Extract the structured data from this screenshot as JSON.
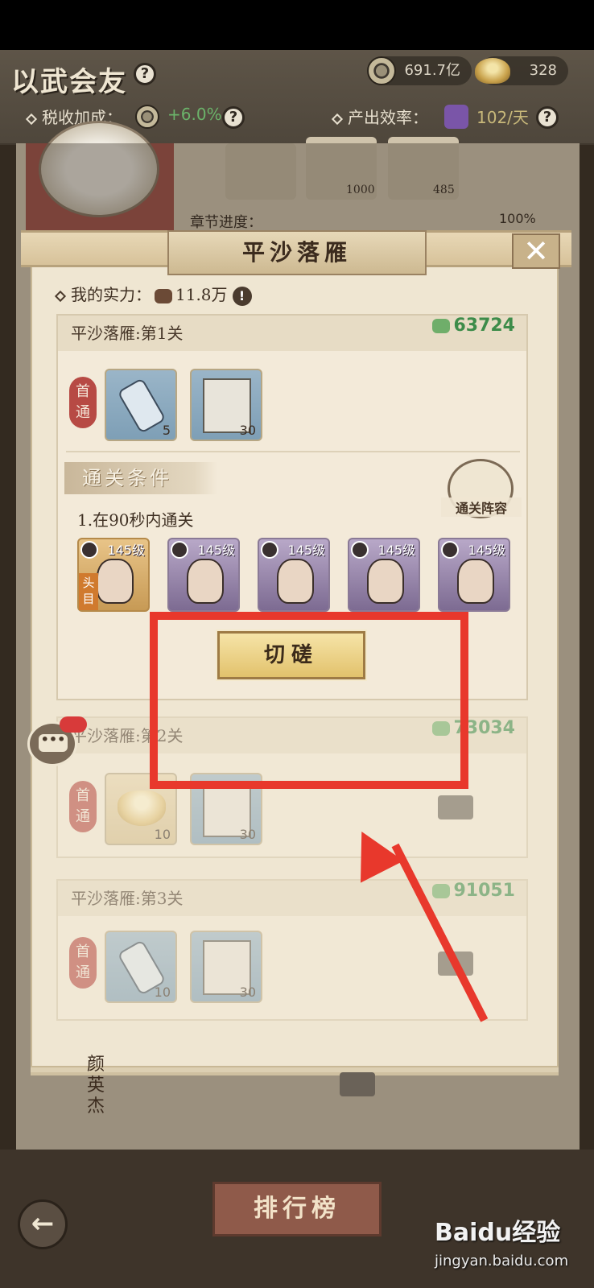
{
  "header": {
    "title": "以武会友",
    "coins": "691.7亿",
    "ingots": "328",
    "tax_label": "税收加成：",
    "tax_value": "+6.0%",
    "output_label": "产出效率：",
    "output_value": "102/天"
  },
  "background": {
    "chapter_progress_label": "章节进度：",
    "chapter_progress_value": "100%",
    "tile_values": [
      "1000",
      "485"
    ],
    "side_name": "颜英杰"
  },
  "dialog": {
    "title": "平沙落雁",
    "power_label": "我的实力：",
    "power_value": "11.8万",
    "first_clear_label": "首通",
    "conditions_title": "通关条件",
    "team_label": "通关阵容",
    "condition_1": "1.在90秒内通关",
    "spar_button": "切磋",
    "stages": [
      {
        "name": "平沙落雁:第1关",
        "power": "63724",
        "rewards": [
          {
            "icon": "scroll",
            "qty": "5"
          },
          {
            "icon": "book",
            "qty": "30"
          }
        ]
      },
      {
        "name": "平沙落雁:第2关",
        "power": "73034",
        "rewards": [
          {
            "icon": "gold-ingot",
            "qty": "10"
          },
          {
            "icon": "book",
            "qty": "30"
          }
        ]
      },
      {
        "name": "平沙落雁:第3关",
        "power": "91051",
        "rewards": [
          {
            "icon": "scroll",
            "qty": "10"
          },
          {
            "icon": "book",
            "qty": "30"
          }
        ]
      }
    ],
    "heroes": [
      {
        "level": "145级",
        "leader": "头目"
      },
      {
        "level": "145级"
      },
      {
        "level": "145级"
      },
      {
        "level": "145级"
      },
      {
        "level": "145级"
      }
    ]
  },
  "bottom": {
    "rank_button": "排行榜",
    "back_icon": "back-arrow-icon"
  },
  "watermark": {
    "brand": "Baidu经验",
    "url": "jingyan.baidu.com"
  },
  "annotation_color": "#e8382c"
}
